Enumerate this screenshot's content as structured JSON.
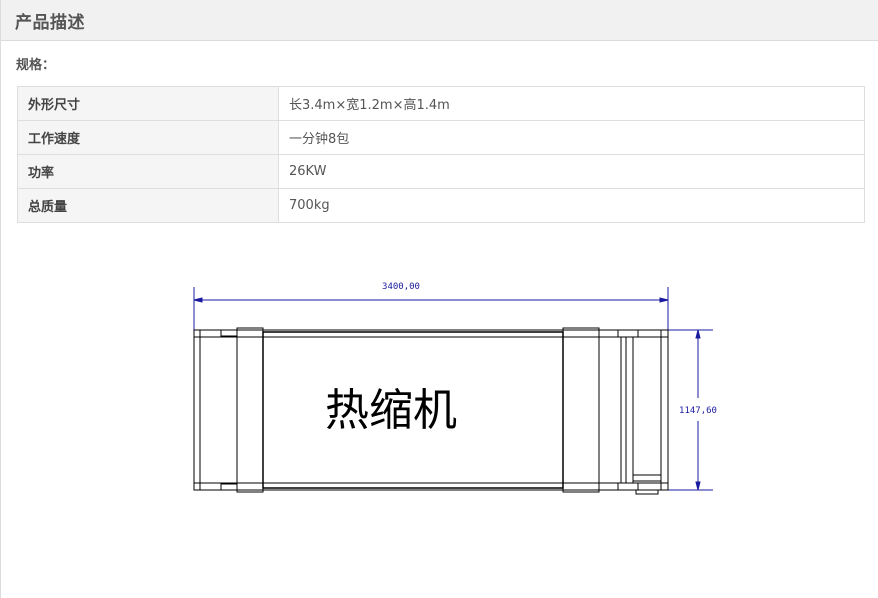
{
  "header": {
    "title": "产品描述"
  },
  "spec": {
    "label": "规格：",
    "rows": [
      {
        "key": "外形尺寸",
        "value": "长3.4m×宽1.2m×高1.4m"
      },
      {
        "key": "工作速度",
        "value": "一分钟8包"
      },
      {
        "key": "功率",
        "value": "26KW"
      },
      {
        "key": "总质量",
        "value": "700kg"
      }
    ]
  },
  "drawing": {
    "title": "热缩机",
    "width_label": "3400,00",
    "height_label": "1147,60",
    "dim_color": "#1a1aa0",
    "line_color": "#000000"
  }
}
